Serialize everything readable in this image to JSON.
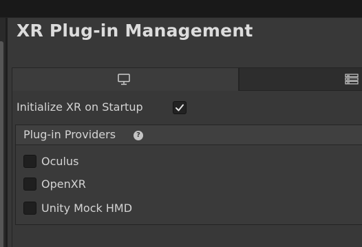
{
  "window": {
    "title": "XR Plug-in Management"
  },
  "tabs": [
    {
      "icon": "monitor-icon",
      "active": true
    },
    {
      "icon": "server-rack-icon",
      "active": false
    }
  ],
  "settings": {
    "initialize_label": "Initialize XR on Startup",
    "initialize_checked": true
  },
  "providers": {
    "header": "Plug-in Providers",
    "help_glyph": "?",
    "items": [
      {
        "label": "Oculus",
        "checked": false
      },
      {
        "label": "OpenXR",
        "checked": false
      },
      {
        "label": "Unity Mock HMD",
        "checked": false
      }
    ]
  },
  "colors": {
    "background": "#383838",
    "text": "#d4d4d4",
    "checkbox": "#1f1f1f",
    "topbar": "#191919"
  }
}
